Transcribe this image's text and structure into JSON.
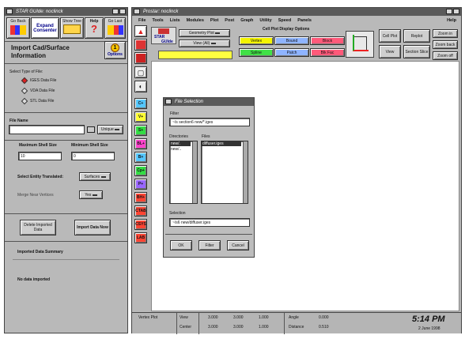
{
  "left": {
    "title": "STAR GUIde: noclinck",
    "tool_buttons": [
      "Go Back",
      "Expand Consenter",
      "Show Tree",
      "Help",
      "Go Last"
    ],
    "options_label": "Options",
    "heading": "Import Cad/Surface Information",
    "select_type": "Select Type of File:",
    "file_types": [
      "IGES Data File",
      "VDA Data File",
      "STL Data File"
    ],
    "file_name_label": "File Name",
    "browse_label": "Unique",
    "max_shell_label": "Maximum Shell Size",
    "max_shell_value": "10",
    "min_shell_label": "Minimum Shell Size",
    "min_shell_value": "0",
    "select_entity_label": "Select Entity Translated:",
    "select_entity_value": "Surfaces",
    "merge_label": "Merge Near Vertices",
    "merge_value": "Yes",
    "delete_btn": "Delete Imported Data",
    "import_btn": "Import Data Now",
    "summary_label": "Imported Data Summary",
    "no_data": "No data imported"
  },
  "main": {
    "title": "Prostar: noclinck",
    "menu": [
      "File",
      "Tools",
      "Lists",
      "Modules",
      "Plot",
      "Post",
      "Graph",
      "Utility",
      "Speed",
      "Panels"
    ],
    "help": "Help",
    "logo_line1": "STAR",
    "logo_line2": "GUIde",
    "plot_select": "Geometry Plot",
    "view_select": "View (All)",
    "cell_plot_header": "Cell Plot Display Options",
    "display_options": [
      {
        "label": "Vertex",
        "color": "#f4f400"
      },
      {
        "label": "Bound",
        "color": "#8fb4ff"
      },
      {
        "label": "Block",
        "color": "#ff5a7a"
      },
      {
        "label": "Spline",
        "color": "#41e047"
      },
      {
        "label": "Patch",
        "color": "#8fb4ff"
      },
      {
        "label": "Blk Fac",
        "color": "#ff5a7a"
      }
    ],
    "right_tools": [
      "Cell Plot",
      "Replot",
      "Zoom in",
      "View",
      "Section Slice",
      "Zoom back",
      "Zoom off"
    ],
    "side_buttons": [
      {
        "label": "C+",
        "color": "#55c6ff"
      },
      {
        "label": "V+",
        "color": "#ffff33"
      },
      {
        "label": "S+",
        "color": "#33dd44"
      },
      {
        "label": "BL+",
        "color": "#ff44cc"
      },
      {
        "label": "B+",
        "color": "#55c6ff"
      },
      {
        "label": "Cp+",
        "color": "#33dd44"
      },
      {
        "label": "P+",
        "color": "#9966ff"
      },
      {
        "label": "BH+",
        "color": "#ff4433"
      },
      {
        "label": "CTAB",
        "color": "#ff4433"
      },
      {
        "label": "CSYS",
        "color": "#ff4433"
      },
      {
        "label": "LAB",
        "color": "#ff4433"
      }
    ]
  },
  "dialog": {
    "title": "File Selection",
    "filter_label": "Filter",
    "filter_value": "~/s section6 new/*.iges",
    "dirs_label": "Directories",
    "files_label": "Files",
    "dirs": [
      "new/.",
      "new/.."
    ],
    "files": [
      "diffuser.iges"
    ],
    "selection_label": "Selection",
    "selection_value": "~/s6 new/diffuser.iges",
    "ok": "OK",
    "filter_btn": "Filter",
    "cancel": "Cancel"
  },
  "status": {
    "mode": "Vertex Plot",
    "view_label": "View",
    "view_values": [
      "3.000",
      "3.000",
      "1.000"
    ],
    "center_label": "Center",
    "center_values": [
      "3.000",
      "3.000",
      "1.000"
    ],
    "angle_label": "Angle",
    "angle_value": "0.000",
    "distance_label": "Distance",
    "distance_value": "0.510",
    "time": "5:14 PM",
    "date": "2 June 1998"
  }
}
